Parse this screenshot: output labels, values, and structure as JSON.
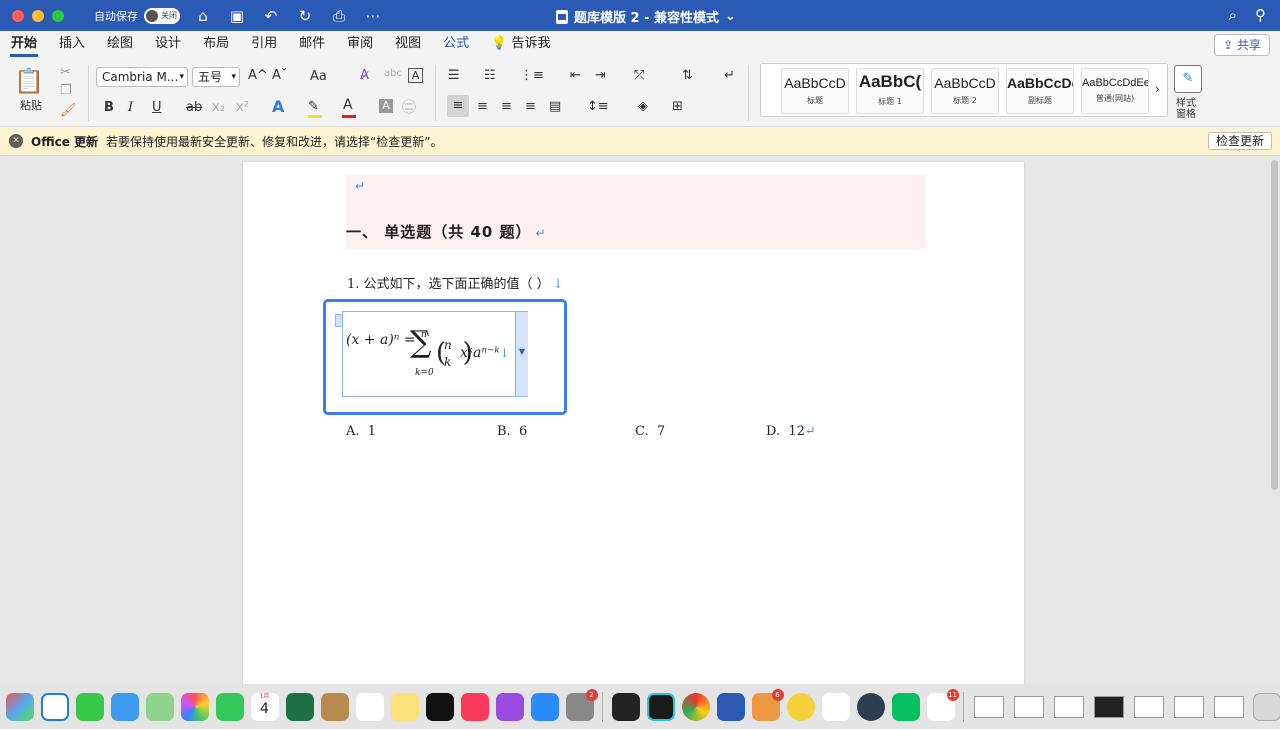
{
  "titlebar": {
    "autosave_label": "自动保存",
    "autosave_state": "关闭",
    "doc_title": "题库模版 2 - 兼容性模式",
    "title_chevron": "⌄"
  },
  "menu": {
    "tabs": [
      "开始",
      "插入",
      "绘图",
      "设计",
      "布局",
      "引用",
      "邮件",
      "审阅",
      "视图",
      "公式",
      "告诉我"
    ],
    "share_label": "共享"
  },
  "ribbon": {
    "paste_label": "粘贴",
    "font_name": "Cambria M...",
    "font_size": "五号",
    "grow_font": "A^",
    "shrink_font": "Aˇ",
    "change_case": "Aa",
    "bold": "B",
    "italic": "I",
    "underline": "U",
    "strike": "ab",
    "subscript": "x₂",
    "superscript": "x²",
    "styles": [
      {
        "sample": "AaBbCcD",
        "name": "标题"
      },
      {
        "sample": "AaBbC(",
        "name": "标题 1"
      },
      {
        "sample": "AaBbCcD",
        "name": "标题 2"
      },
      {
        "sample": "AaBbCcDe",
        "name": "副标题"
      },
      {
        "sample": "AaBbCcDdEe",
        "name": "普通(网站)"
      }
    ],
    "styles_pane_label_1": "样式",
    "styles_pane_label_2": "窗格"
  },
  "notification": {
    "title": "Office 更新",
    "message": "若要保持使用最新安全更新、修复和改进，请选择“检查更新”。",
    "button": "检查更新"
  },
  "document": {
    "para_mark": "↵",
    "heading": "一、  单选题（共 40 题）",
    "question": "1.  公式如下，选下面正确的值（        ）",
    "down_arrow": "↓",
    "equation": {
      "lhs": "(x + a)ⁿ =",
      "sum_upper": "n",
      "sum_lower": "k=0",
      "binom_top": "n",
      "binom_bottom": "k",
      "term": "xᵏaⁿ⁻ᵏ"
    },
    "options": [
      {
        "label": "A.",
        "value": "1"
      },
      {
        "label": "B.",
        "value": "6"
      },
      {
        "label": "C.",
        "value": "7"
      },
      {
        "label": "D.",
        "value": "12"
      }
    ]
  },
  "dock": {
    "calendar_month": "1月",
    "calendar_day": "4",
    "badges": {
      "system_prefs": "2",
      "installer": "6",
      "mail_app": "11"
    }
  }
}
